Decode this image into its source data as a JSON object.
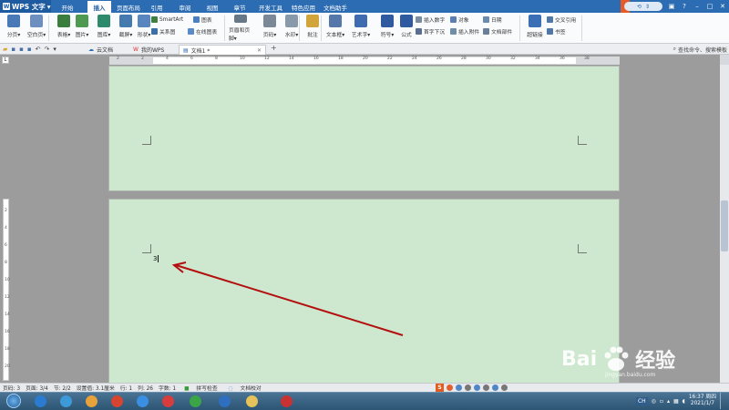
{
  "app": {
    "title": "WPS 文字"
  },
  "menu_tabs": [
    "开始",
    "插入",
    "页面布局",
    "引用",
    "审阅",
    "视图",
    "章节",
    "开发工具",
    "特色应用",
    "文档助手"
  ],
  "active_menu_tab": "插入",
  "ribbon": {
    "big": [
      {
        "label": "分页",
        "icon": "page-break-icon",
        "color": "#4a79b8"
      },
      {
        "label": "空白页",
        "icon": "blank-page-icon",
        "color": "#6d8fc0"
      },
      {
        "label": "表格",
        "icon": "table-icon",
        "color": "#3b7d3d"
      },
      {
        "label": "图片",
        "icon": "picture-icon",
        "color": "#4f9a51"
      },
      {
        "label": "图库",
        "icon": "gallery-icon",
        "color": "#2d8a6a"
      },
      {
        "label": "截屏",
        "icon": "screenshot-icon",
        "color": "#447ab0"
      },
      {
        "label": "形状",
        "icon": "shape-icon",
        "color": "#5a86c0"
      },
      {
        "label": "页眉和页脚",
        "icon": "header-footer-icon",
        "color": "#667788"
      },
      {
        "label": "页码",
        "icon": "page-number-icon",
        "color": "#7a8898"
      },
      {
        "label": "水印",
        "icon": "watermark-icon",
        "color": "#8899aa"
      },
      {
        "label": "批注",
        "icon": "comment-icon",
        "color": "#d2a53a"
      },
      {
        "label": "文本框",
        "icon": "textbox-icon",
        "color": "#5577aa"
      },
      {
        "label": "艺术字",
        "icon": "wordart-icon",
        "color": "#3f6bb0"
      },
      {
        "label": "符号",
        "icon": "symbol-icon",
        "color": "#2f5aa0"
      },
      {
        "label": "公式",
        "icon": "formula-icon",
        "color": "#2f5aa0"
      },
      {
        "label": "超链接",
        "icon": "hyperlink-icon",
        "color": "#3b6fb5"
      }
    ],
    "small": {
      "smartart": "SmartArt",
      "chart": "图表",
      "relation": "关系图",
      "online_chart": "在线图表",
      "insert_number": "插入数字",
      "object": "对象",
      "date": "日期",
      "dropcap": "首字下沉",
      "attachment": "插入附件",
      "doc_parts": "文档部件",
      "cross_ref": "交叉引用",
      "bookmark": "书签"
    }
  },
  "doc_tabs": [
    {
      "label": "云文档",
      "icon": "cloud-icon"
    },
    {
      "label": "我的WPS",
      "icon": "wps-home-icon"
    },
    {
      "label": "文档1 *",
      "icon": "doc-icon"
    }
  ],
  "active_doc_tab": "文档1 *",
  "command_search": "查找命令、搜索模板",
  "ruler": {
    "ticks": [
      "2",
      "2",
      "4",
      "6",
      "8",
      "10",
      "12",
      "14",
      "16",
      "18",
      "20",
      "22",
      "24",
      "26",
      "28",
      "30",
      "32",
      "34",
      "36",
      "38"
    ]
  },
  "vruler": {
    "ticks": [
      "2",
      "4",
      "6",
      "8",
      "10",
      "12",
      "14",
      "16",
      "18",
      "20"
    ]
  },
  "document": {
    "cursor_text": "3"
  },
  "status": {
    "page_num": "页码: 3",
    "pages": "页面: 3/4",
    "section": "节: 2/2",
    "setting": "设置值: 3.1厘米",
    "row": "行: 1",
    "col": "列: 26",
    "words": "字数: 1",
    "spell": "拼写检查",
    "doc_check": "文档校对"
  },
  "ime": {
    "label": "S"
  },
  "taskbar": {
    "apps": [
      {
        "name": "ie-icon",
        "color": "#2b7bd0"
      },
      {
        "name": "search-icon",
        "color": "#3d9ad8"
      },
      {
        "name": "paint-icon",
        "color": "#e8a23b"
      },
      {
        "name": "chrome-icon",
        "color": "#d7442f"
      },
      {
        "name": "baidu-netdisk-icon",
        "color": "#3b8fe2"
      },
      {
        "name": "wps-pdf-icon",
        "color": "#d83c3c"
      },
      {
        "name": "qihoo-icon",
        "color": "#3aa447"
      },
      {
        "name": "wps-writer-icon",
        "color": "#2f6fbf"
      },
      {
        "name": "explorer-icon",
        "color": "#e5c35a"
      },
      {
        "name": "antivirus-icon",
        "color": "#c83232"
      }
    ]
  },
  "tray": {
    "lang": "CH",
    "time": "16:37 周四",
    "date": "2021/1/7"
  },
  "watermark": {
    "brand": "Bai",
    "brand2": "经验",
    "sub": "jingyan.baidu.com"
  },
  "colors": {
    "title": "#2c6cb3",
    "page": "#cde8ce",
    "arrow": "#b30f0f"
  }
}
